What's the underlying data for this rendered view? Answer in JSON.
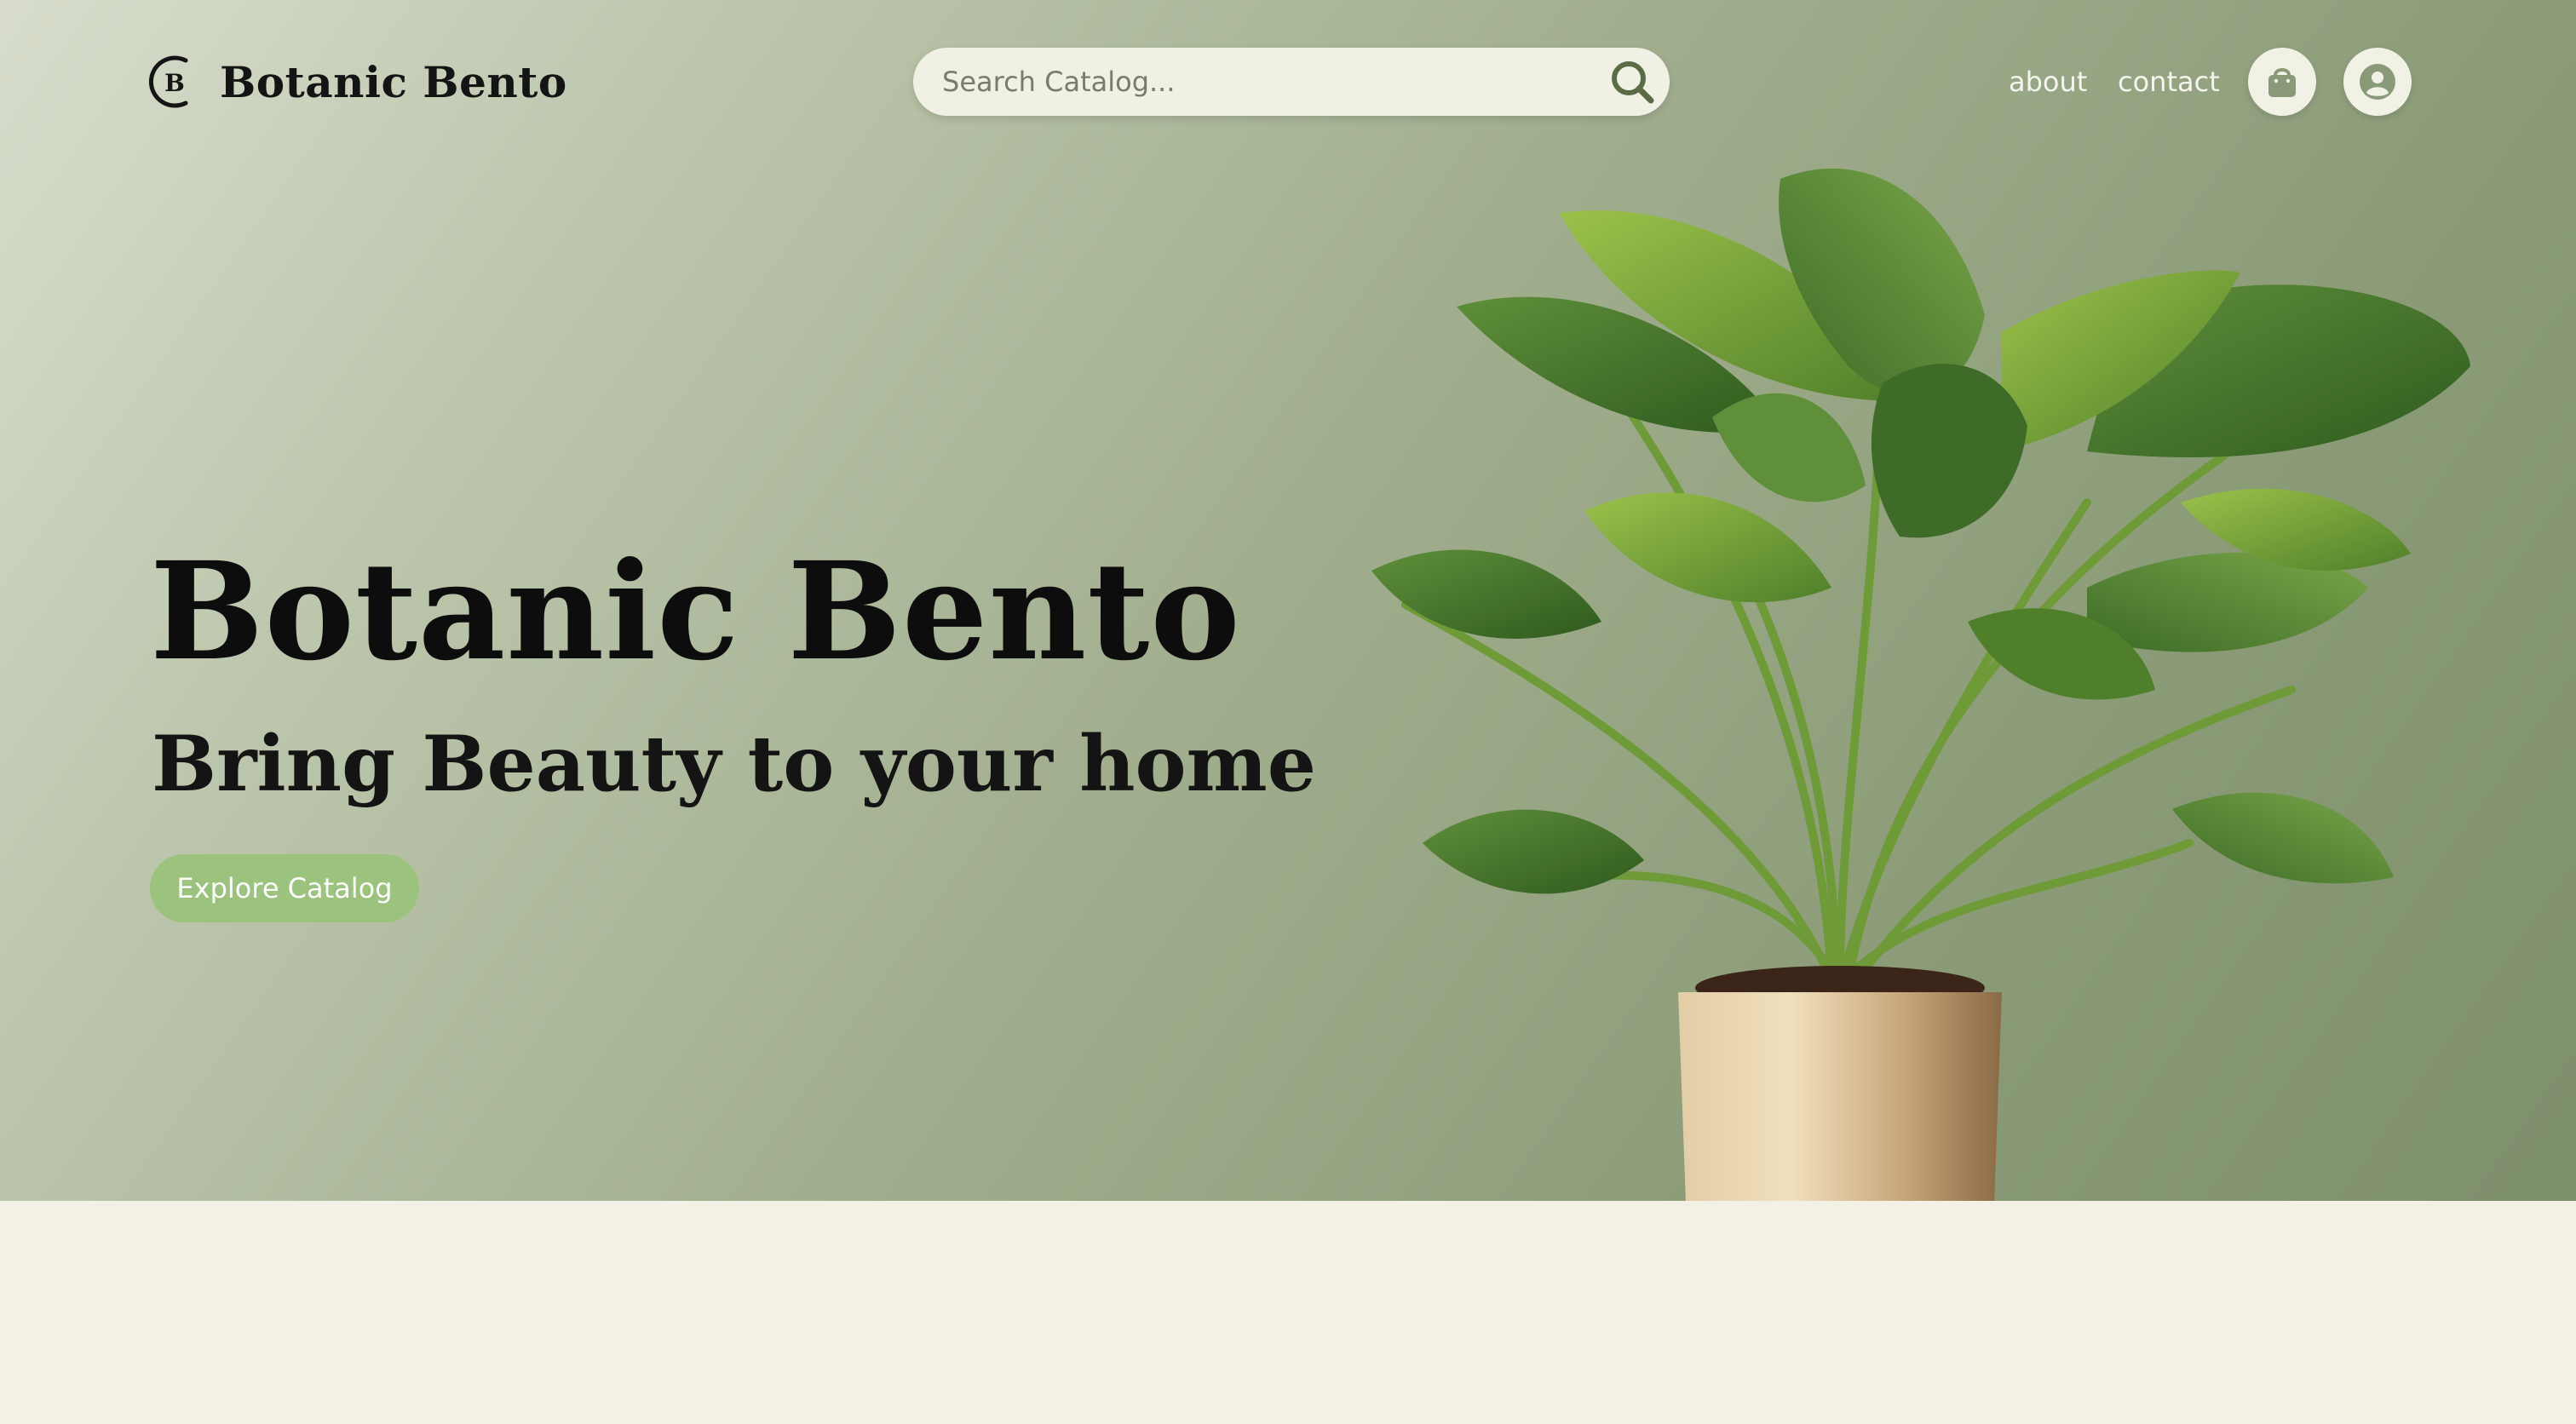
{
  "header": {
    "brand": "Botanic Bento",
    "logo_letter": "B",
    "search": {
      "placeholder": "Search Catalog..."
    },
    "nav": {
      "about": "about",
      "contact": "contact"
    },
    "icons": {
      "search": "search-icon",
      "bag": "shopping-bag-icon",
      "user": "user-account-icon"
    }
  },
  "hero": {
    "title": "Botanic Bento",
    "subtitle": "Bring Beauty to your home",
    "cta_label": "Explore Catalog",
    "image": "potted-plant-image"
  },
  "colors": {
    "accent": "#9cc37e",
    "hero_bg_start": "#d8ddcd",
    "hero_bg_end": "#7e8f6c",
    "floor": "#f3f1e6",
    "text_dark": "#0d0d0d",
    "search_bg": "#f1f0e4"
  }
}
